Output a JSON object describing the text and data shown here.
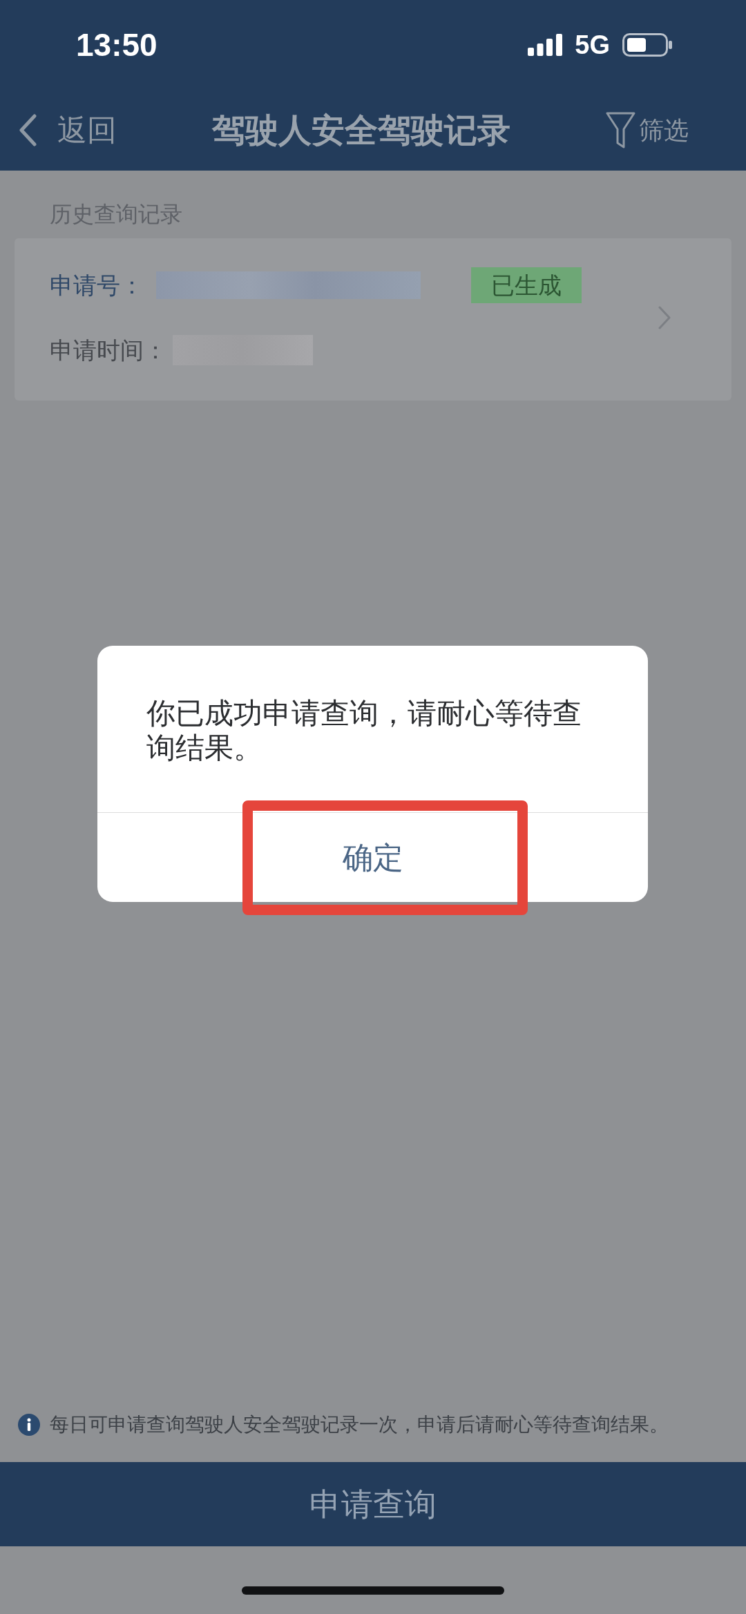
{
  "status_bar": {
    "time": "13:50",
    "network": "5G"
  },
  "header": {
    "back": "返回",
    "title": "驾驶人安全驾驶记录",
    "filter": "筛选"
  },
  "history": {
    "title": "历史查询记录",
    "records": [
      {
        "fields": [
          {
            "label": "申请号：",
            "redacted": true
          },
          {
            "label": "申请时间：",
            "redacted": true
          }
        ],
        "status": "已生成"
      }
    ]
  },
  "dialog": {
    "message": "你已成功申请查询，请耐心等待查询结果。",
    "button": {
      "label": "确定",
      "highlighted": true
    }
  },
  "notice": "每日可申请查询驾驶人安全驾驶记录一次，申请后请耐心等待查询结果。",
  "primary_button": "申请查询"
}
